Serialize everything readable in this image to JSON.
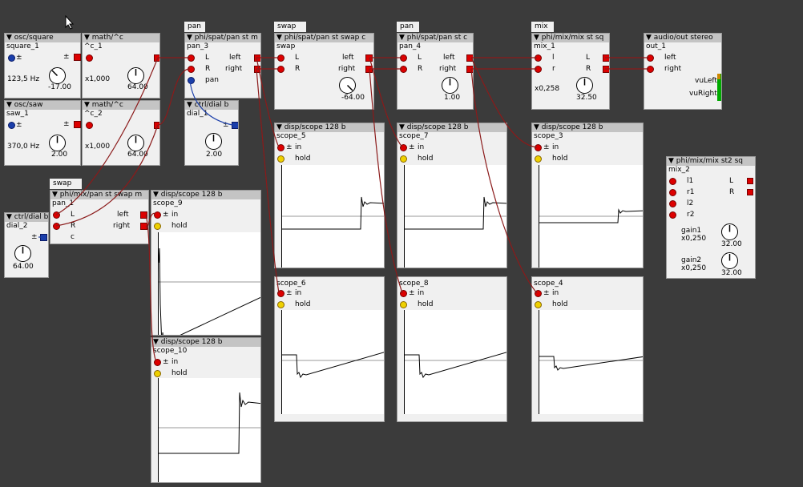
{
  "groups": {
    "pan_a": "pan",
    "swap": "swap",
    "pan_b": "pan",
    "mix": "mix",
    "swap_m": "swap m"
  },
  "osc_square": {
    "title": "▼ osc/square",
    "name": "square_1",
    "freq": "123,5 Hz",
    "pitch": "-17.00"
  },
  "math_c1": {
    "title": "▼ math/^c",
    "name": "^c_1",
    "mult": "x1,000",
    "amt": "64.00"
  },
  "osc_saw": {
    "title": "▼ osc/saw",
    "name": "saw_1",
    "freq": "370,0 Hz",
    "pitch": "2.00"
  },
  "math_c2": {
    "title": "▼ math/^c",
    "name": "^c_2",
    "mult": "x1,000",
    "amt": "64.00"
  },
  "pan3": {
    "title": "▼ phi/spat/pan st m",
    "name": "pan_3",
    "in_l": "L",
    "in_r": "R",
    "in_pan": "pan",
    "out_l": "left",
    "out_r": "right"
  },
  "dial1": {
    "title": "▼ ctrl/dial b",
    "name": "dial_1",
    "value": "2.00"
  },
  "swapc": {
    "title": "▼ phi/spat/pan st swap c",
    "name": "swap",
    "in_l": "L",
    "in_r": "R",
    "out_l": "left",
    "out_r": "right",
    "value": "-64.00"
  },
  "pan4": {
    "title": "▼ phi/spat/pan st c",
    "name": "pan_4",
    "in_l": "L",
    "in_r": "R",
    "out_l": "left",
    "out_r": "right",
    "value": "1.00"
  },
  "mix1": {
    "title": "▼ phi/mix/mix st sq",
    "name": "mix_1",
    "in_l": "l",
    "in_r": "r",
    "out_l": "L",
    "out_r": "R",
    "gain": "x0,258",
    "value": "32.50"
  },
  "out1": {
    "title": "▼ audio/out stereo",
    "name": "out_1",
    "in_l": "left",
    "in_r": "right",
    "vu_l": "vuLeft",
    "vu_r": "vuRight"
  },
  "mix2": {
    "title": "▼ phi/mix/mix st2 sq",
    "name": "mix_2",
    "in1": "l1",
    "in2": "r1",
    "in3": "l2",
    "in4": "r2",
    "out_l": "L",
    "out_r": "R",
    "gain1": "gain1",
    "gain1_val": "x0,250",
    "g1": "32.00",
    "gain2": "gain2",
    "gain2_val": "x0,250",
    "g2": "32.00"
  },
  "pan1": {
    "title": "▼ phi/mix/pan st swap m",
    "name": "pan_1",
    "in_l": "L",
    "in_r": "R",
    "in_c": "c",
    "out_l": "left",
    "out_r": "right"
  },
  "dial2": {
    "title": "▼ ctrl/dial b",
    "name": "dial_2",
    "value": "64.00"
  },
  "scope_common": {
    "title": "▼ disp/scope 128 b",
    "in": "in",
    "hold": "hold",
    "pm": "±"
  },
  "scopes": {
    "s9": "scope_9",
    "s10": "scope_10",
    "s5": "scope_5",
    "s6": "scope_6",
    "s7": "scope_7",
    "s8": "scope_8",
    "s3": "scope_3",
    "s4": "scope_4"
  },
  "colors": {
    "bg": "#3b3b3b",
    "box": "#f0f0f0",
    "header": "#c4c4c4",
    "wire": "#8b1a1a",
    "wire_blue": "#1a3eaa",
    "inlet": "#dd0000"
  }
}
